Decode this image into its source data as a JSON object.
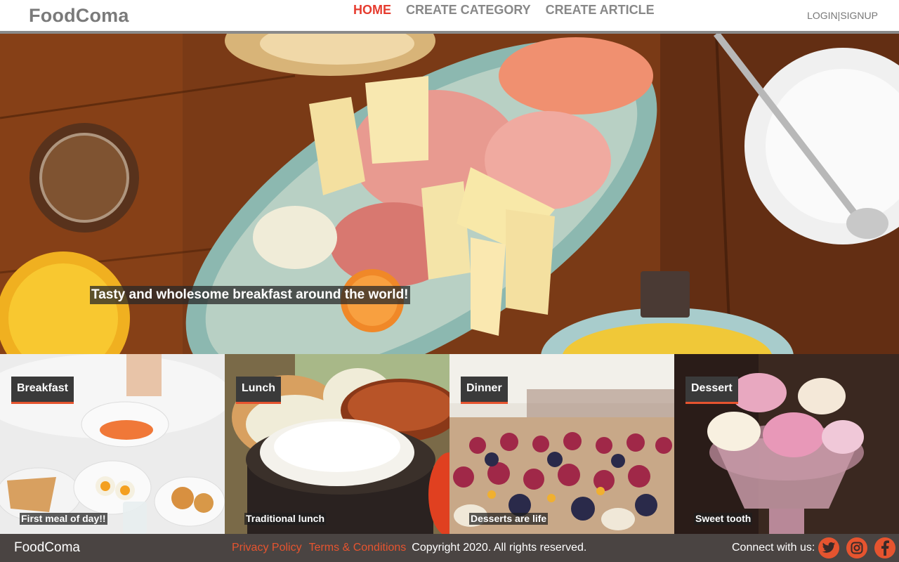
{
  "header": {
    "logo": "FoodComa",
    "nav": [
      {
        "label": "HOME",
        "active": true
      },
      {
        "label": "CREATE CATEGORY",
        "active": false
      },
      {
        "label": "CREATE ARTICLE",
        "active": false
      }
    ],
    "login": "LOGIN",
    "separator": "|",
    "signup": "SIGNUP"
  },
  "hero": {
    "caption": "Tasty and wholesome breakfast around the world!"
  },
  "categories": [
    {
      "label": "Breakfast",
      "caption": "First meal of day!!"
    },
    {
      "label": "Lunch",
      "caption": "Traditional lunch"
    },
    {
      "label": "Dinner",
      "caption": "Desserts are life"
    },
    {
      "label": "Dessert",
      "caption": "Sweet tooth"
    }
  ],
  "footer": {
    "logo": "FoodComa",
    "privacy": "Privacy Policy",
    "terms": "Terms & Conditions",
    "copyright": "Copyright 2020. All rights reserved.",
    "connect": "Connect with us:",
    "social_icons": [
      "twitter-icon",
      "instagram-icon",
      "facebook-icon"
    ]
  },
  "colors": {
    "accent": "#e63c2f",
    "footer_bg": "#4a4442",
    "badge_bg": "#3a3a3a",
    "badge_underline": "#e6542f"
  }
}
